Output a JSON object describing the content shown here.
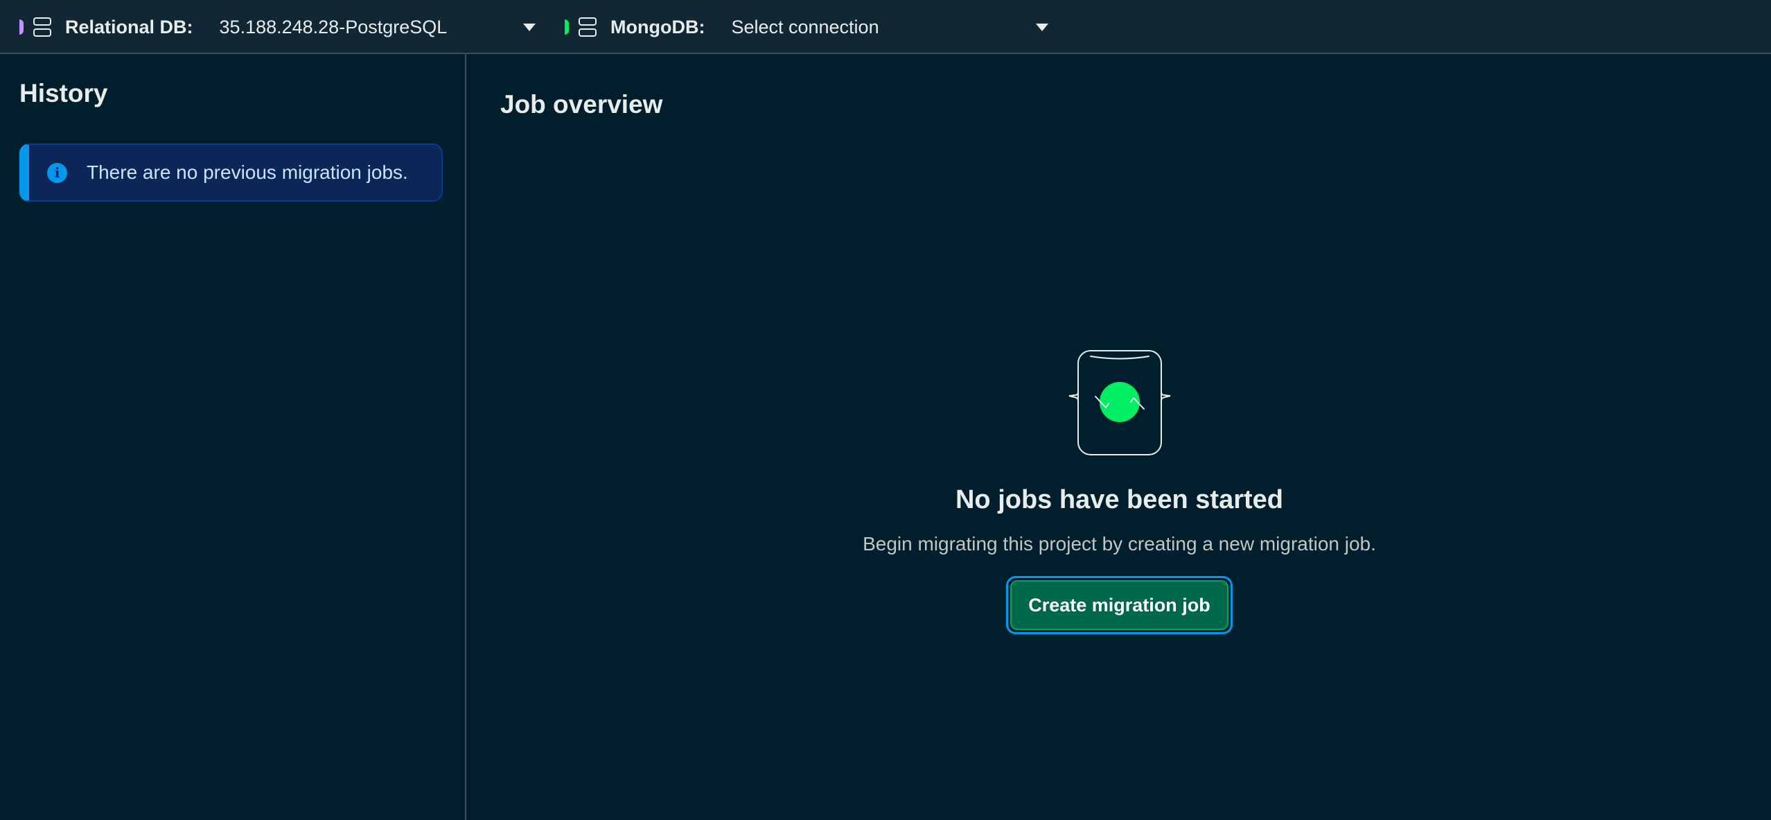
{
  "topbar": {
    "relational": {
      "label": "Relational DB:",
      "value": "35.188.248.28-PostgreSQL",
      "marker_color": "#c78fff",
      "icon": "database-icon"
    },
    "mongo": {
      "label": "MongoDB:",
      "value": "Select connection",
      "marker_color": "#00ed64",
      "icon": "database-icon"
    }
  },
  "sidebar": {
    "title": "History",
    "banner": {
      "icon": "info-icon",
      "text": "There are no previous migration jobs."
    }
  },
  "main": {
    "title": "Job overview",
    "empty_state": {
      "title": "No jobs have been started",
      "description": "Begin migrating this project by creating a new migration job.",
      "button_label": "Create migration job"
    }
  },
  "colors": {
    "background": "#001e2b",
    "topbar": "#112733",
    "accent_green": "#00ed64",
    "button_green": "#00684a",
    "focus_blue": "#0498ec",
    "info_banner": "#0c2657"
  }
}
